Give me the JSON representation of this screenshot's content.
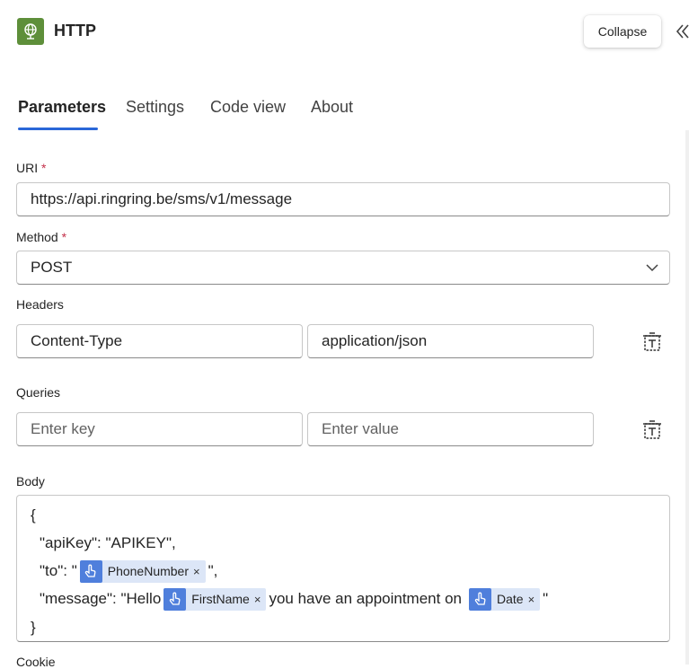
{
  "header": {
    "title": "HTTP",
    "collapse_label": "Collapse",
    "icon": "globe-icon",
    "brand_color": "#5e8f3a"
  },
  "tabs": [
    {
      "label": "Parameters",
      "active": true
    },
    {
      "label": "Settings",
      "active": false
    },
    {
      "label": "Code view",
      "active": false
    },
    {
      "label": "About",
      "active": false
    }
  ],
  "accent_color": "#2a67d8",
  "uri": {
    "label": "URI",
    "required_mark": "*",
    "value": "https://api.ringring.be/sms/v1/message"
  },
  "method": {
    "label": "Method",
    "required_mark": "*",
    "value": "POST"
  },
  "headers": {
    "label": "Headers",
    "key": "Content-Type",
    "value": "application/json"
  },
  "queries": {
    "label": "Queries",
    "key_placeholder": "Enter key",
    "value_placeholder": "Enter value"
  },
  "body": {
    "label": "Body",
    "open_brace": "{",
    "line1": "\"apiKey\": \"APIKEY\",",
    "line2_prefix": "\"to\": \"",
    "token_phone": "PhoneNumber",
    "line2_suffix": "\",",
    "line3_prefix": "\"message\": \"Hello",
    "token_firstname": "FirstName",
    "line3_middle": "you have an appointment on",
    "token_date": "Date",
    "line3_suffix": "\"",
    "close_brace": "}",
    "token_remove_symbol": "×"
  },
  "cookie": {
    "label": "Cookie"
  }
}
